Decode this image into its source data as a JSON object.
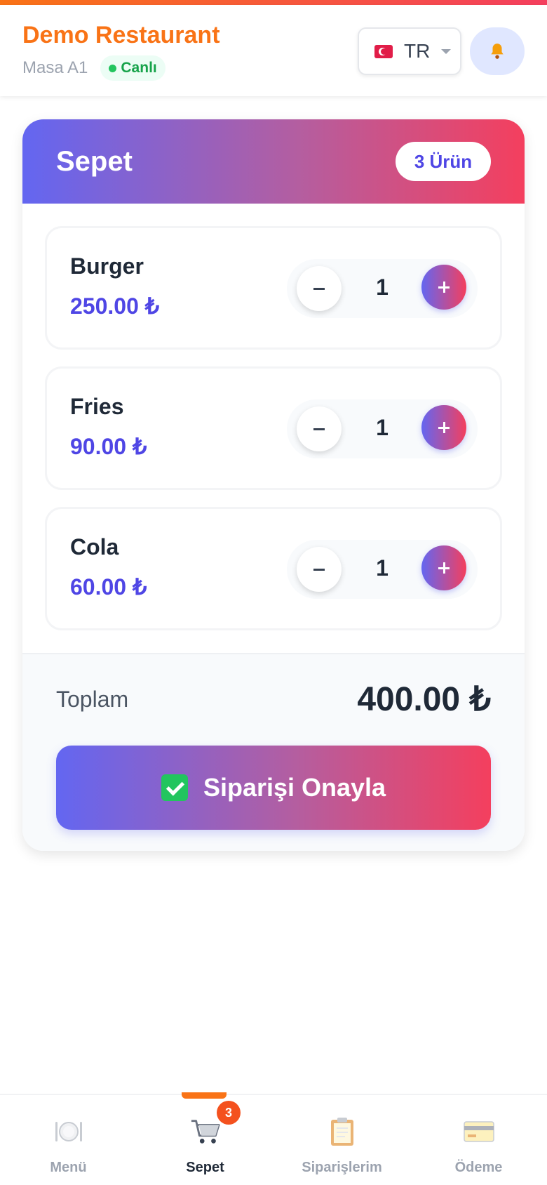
{
  "header": {
    "restaurant_name": "Demo Restaurant",
    "table_label": "Masa A1",
    "live_label": "Canlı",
    "language_code": "TR"
  },
  "cart": {
    "title": "Sepet",
    "count_label": "3 Ürün",
    "items": [
      {
        "name": "Burger",
        "price": "250.00 ₺",
        "quantity": "1"
      },
      {
        "name": "Fries",
        "price": "90.00 ₺",
        "quantity": "1"
      },
      {
        "name": "Cola",
        "price": "60.00 ₺",
        "quantity": "1"
      }
    ],
    "total_label": "Toplam",
    "total_value": "400.00 ₺",
    "confirm_label": "Siparişi Onayla"
  },
  "nav": {
    "items": [
      {
        "label": "Menü",
        "icon": "plate-cutlery-icon"
      },
      {
        "label": "Sepet",
        "icon": "shopping-cart-icon",
        "badge": "3",
        "active": true
      },
      {
        "label": "Siparişlerim",
        "icon": "clipboard-icon"
      },
      {
        "label": "Ödeme",
        "icon": "credit-card-icon"
      }
    ]
  },
  "colors": {
    "brand_orange": "#f97316",
    "accent_indigo": "#4f46e5",
    "accent_red": "#f43f5e",
    "live_green": "#16a34a"
  }
}
